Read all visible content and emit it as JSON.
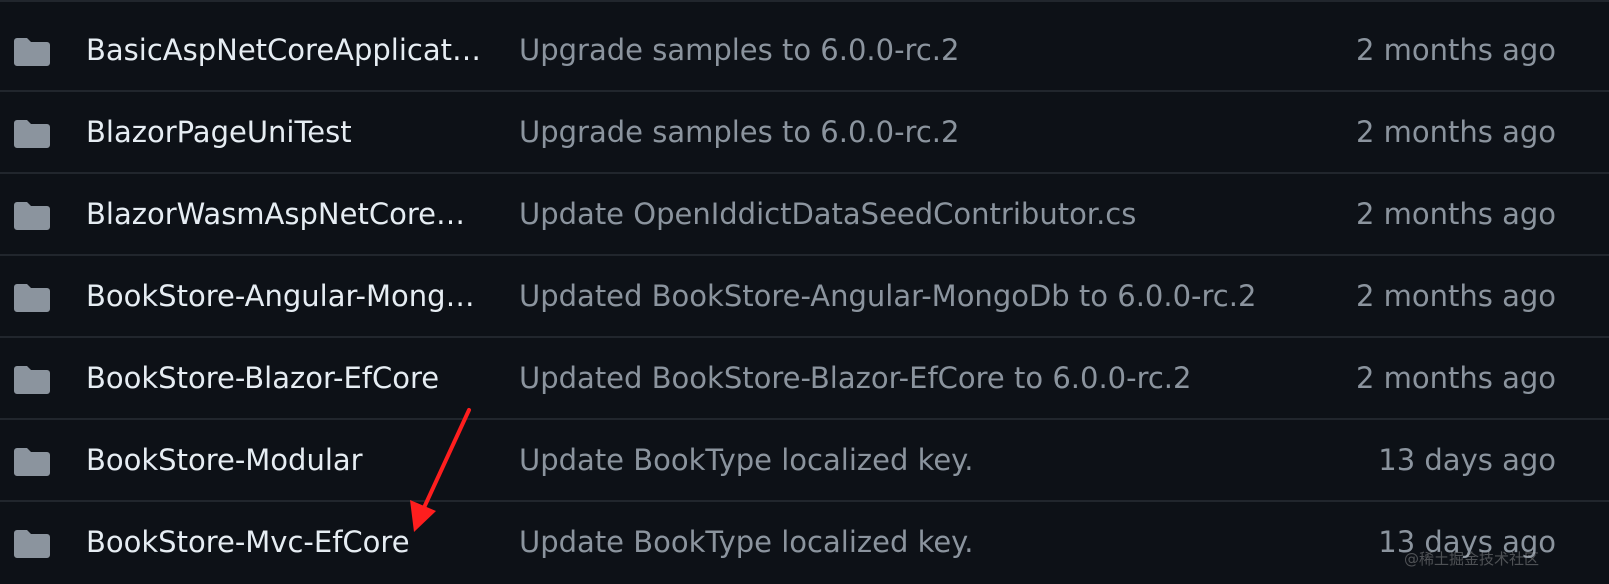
{
  "files": [
    {
      "name": "BasicAspNetCoreApplication",
      "message": "Upgrade samples to 6.0.0-rc.2",
      "age": "2 months ago"
    },
    {
      "name": "BlazorPageUniTest",
      "message": "Upgrade samples to 6.0.0-rc.2",
      "age": "2 months ago"
    },
    {
      "name": "BlazorWasmAspNetCoreHo...",
      "message": "Update OpenIddictDataSeedContributor.cs",
      "age": "2 months ago"
    },
    {
      "name": "BookStore-Angular-Mongo...",
      "message": "Updated BookStore-Angular-MongoDb to 6.0.0-rc.2",
      "age": "2 months ago"
    },
    {
      "name": "BookStore-Blazor-EfCore",
      "message": "Updated BookStore-Blazor-EfCore to 6.0.0-rc.2",
      "age": "2 months ago"
    },
    {
      "name": "BookStore-Modular",
      "message": "Update BookType localized key.",
      "age": "13 days ago"
    },
    {
      "name": "BookStore-Mvc-EfCore",
      "message": "Update BookType localized key.",
      "age": "13 days ago"
    }
  ],
  "icons": {
    "row_icon": "folder-icon",
    "annotation": "red-arrow-icon"
  },
  "colors": {
    "background": "#0d1117",
    "divider": "#21262d",
    "name_text": "#e6edf3",
    "secondary_text": "#8b949e",
    "folder_icon": "#8b949e",
    "annotation_arrow": "#ff1e1e"
  },
  "watermark": "@稀土掘金技术社区"
}
